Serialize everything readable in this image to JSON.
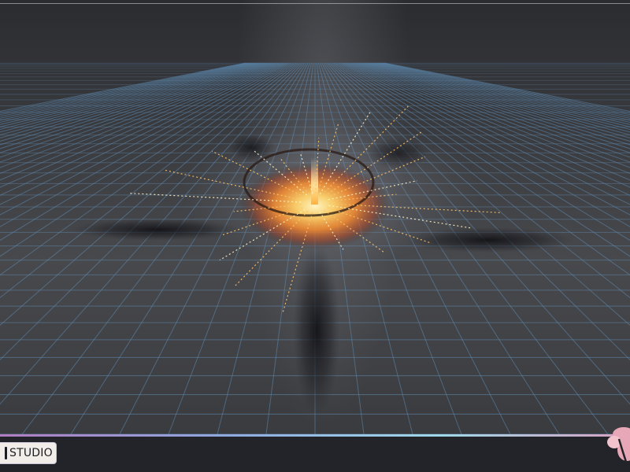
{
  "viewport": {
    "scene": "particle-explosion-preview"
  },
  "brand": {
    "label": "STUDIO"
  },
  "colors": {
    "grid_line": "#5f8ab0",
    "grid_glow": "#8fb4d6",
    "background_top": "#2b2c2f",
    "background_mid": "#48494d",
    "fire_core": "#ffe28a",
    "fire_mid": "#ff8c2a",
    "fire_edge": "#b3401a",
    "smoke": "#111114",
    "accent_purple": "#b07cc0",
    "accent_cyan": "#9fd8e8",
    "logo_pink": "#e7a7b6"
  },
  "icons": {
    "corner_logo": "flower-logo-icon"
  }
}
